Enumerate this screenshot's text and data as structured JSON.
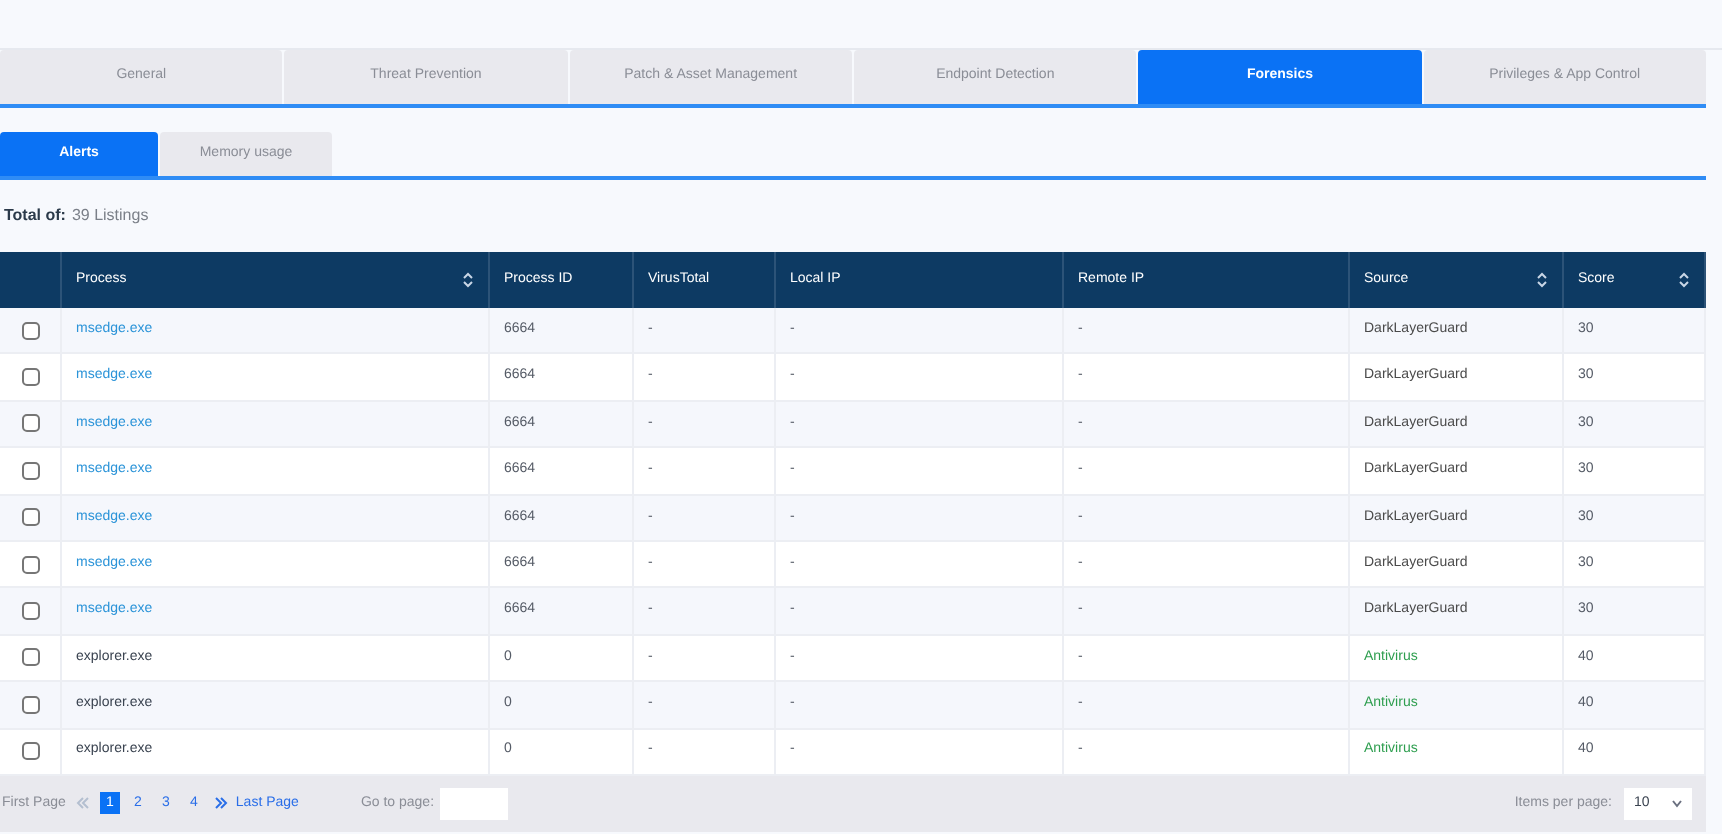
{
  "tabs": [
    {
      "label": "General",
      "selected": false
    },
    {
      "label": "Threat Prevention",
      "selected": false
    },
    {
      "label": "Patch & Asset Management",
      "selected": false
    },
    {
      "label": "Endpoint Detection",
      "selected": false
    },
    {
      "label": "Forensics",
      "selected": true
    },
    {
      "label": "Privileges & App Control",
      "selected": false
    }
  ],
  "subtabs": [
    {
      "label": "Alerts",
      "selected": true
    },
    {
      "label": "Memory usage",
      "selected": false
    }
  ],
  "total": {
    "label": "Total of:",
    "value": "39 Listings"
  },
  "table": {
    "columns": [
      {
        "label": "Process",
        "sortable": true
      },
      {
        "label": "Process ID",
        "sortable": false
      },
      {
        "label": "VirusTotal",
        "sortable": false
      },
      {
        "label": "Local IP",
        "sortable": false
      },
      {
        "label": "Remote IP",
        "sortable": false
      },
      {
        "label": "Source",
        "sortable": true
      },
      {
        "label": "Score",
        "sortable": true
      }
    ],
    "rows": [
      {
        "checked": false,
        "kind": "link",
        "color": "#4a4a4a",
        "cells": [
          "msedge.exe",
          "6664",
          "-",
          "-",
          "-",
          "DarkLayerGuard",
          "30"
        ]
      },
      {
        "checked": false,
        "kind": "link",
        "color": "#4a4a4a",
        "cells": [
          "msedge.exe",
          "6664",
          "-",
          "-",
          "-",
          "DarkLayerGuard",
          "30"
        ]
      },
      {
        "checked": false,
        "kind": "link",
        "color": "#4a4a4a",
        "cells": [
          "msedge.exe",
          "6664",
          "-",
          "-",
          "-",
          "DarkLayerGuard",
          "30"
        ]
      },
      {
        "checked": false,
        "kind": "link",
        "color": "#4a4a4a",
        "cells": [
          "msedge.exe",
          "6664",
          "-",
          "-",
          "-",
          "DarkLayerGuard",
          "30"
        ]
      },
      {
        "checked": false,
        "kind": "link",
        "color": "#4a4a4a",
        "cells": [
          "msedge.exe",
          "6664",
          "-",
          "-",
          "-",
          "DarkLayerGuard",
          "30"
        ]
      },
      {
        "checked": false,
        "kind": "link",
        "color": "#4a4a4a",
        "cells": [
          "msedge.exe",
          "6664",
          "-",
          "-",
          "-",
          "DarkLayerGuard",
          "30"
        ]
      },
      {
        "checked": false,
        "kind": "link",
        "color": "#4a4a4a",
        "cells": [
          "msedge.exe",
          "6664",
          "-",
          "-",
          "-",
          "DarkLayerGuard",
          "30"
        ]
      },
      {
        "checked": false,
        "kind": "plain",
        "color": "#2e9e4f",
        "cells": [
          "explorer.exe",
          "0",
          "-",
          "-",
          "-",
          "Antivirus",
          "40"
        ]
      },
      {
        "checked": false,
        "kind": "plain",
        "color": "#2e9e4f",
        "cells": [
          "explorer.exe",
          "0",
          "-",
          "-",
          "-",
          "Antivirus",
          "40"
        ]
      },
      {
        "checked": false,
        "kind": "plain",
        "color": "#2e9e4f",
        "cells": [
          "explorer.exe",
          "0",
          "-",
          "-",
          "-",
          "Antivirus",
          "40"
        ]
      }
    ]
  },
  "pager": {
    "first": "First Page",
    "pages": [
      {
        "label": "1",
        "selected": true
      },
      {
        "label": "2",
        "selected": false
      },
      {
        "label": "3",
        "selected": false
      },
      {
        "label": "4",
        "selected": false
      }
    ],
    "last": "Last Page",
    "goto_label": "Go to page:",
    "per_page_label": "Items per page:",
    "per_page": "10"
  }
}
